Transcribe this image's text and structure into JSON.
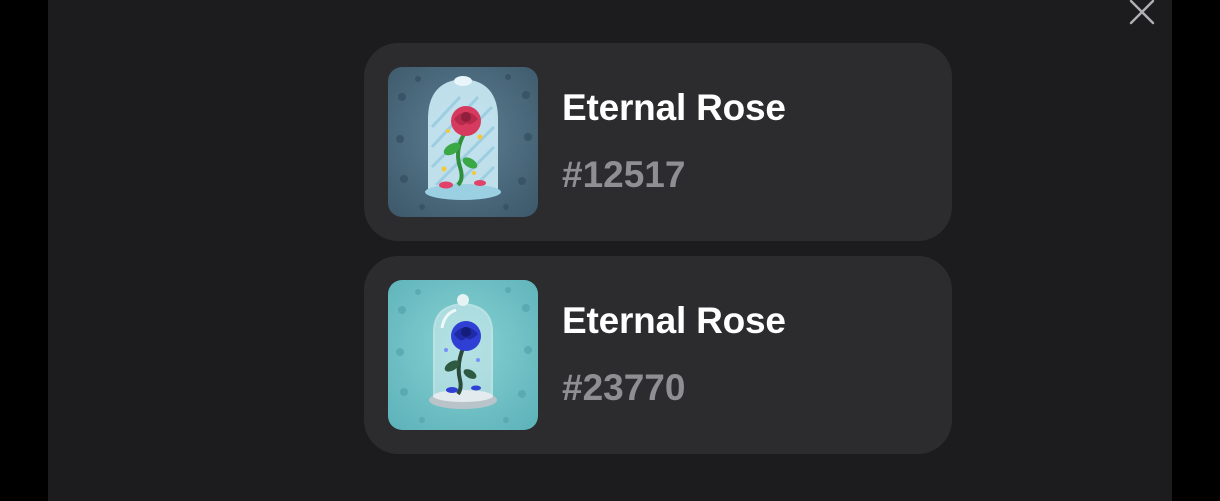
{
  "modal": {
    "close_icon": "close-icon",
    "background_color": "#1c1c1e",
    "card_color": "#2c2c2e"
  },
  "items": [
    {
      "name": "Eternal Rose",
      "number": "#12517",
      "image": "red-rose-glass-dome",
      "thumb_color": "#4a6b80"
    },
    {
      "name": "Eternal Rose",
      "number": "#23770",
      "image": "blue-rose-glass-dome",
      "thumb_color": "#6cbcc2"
    }
  ]
}
